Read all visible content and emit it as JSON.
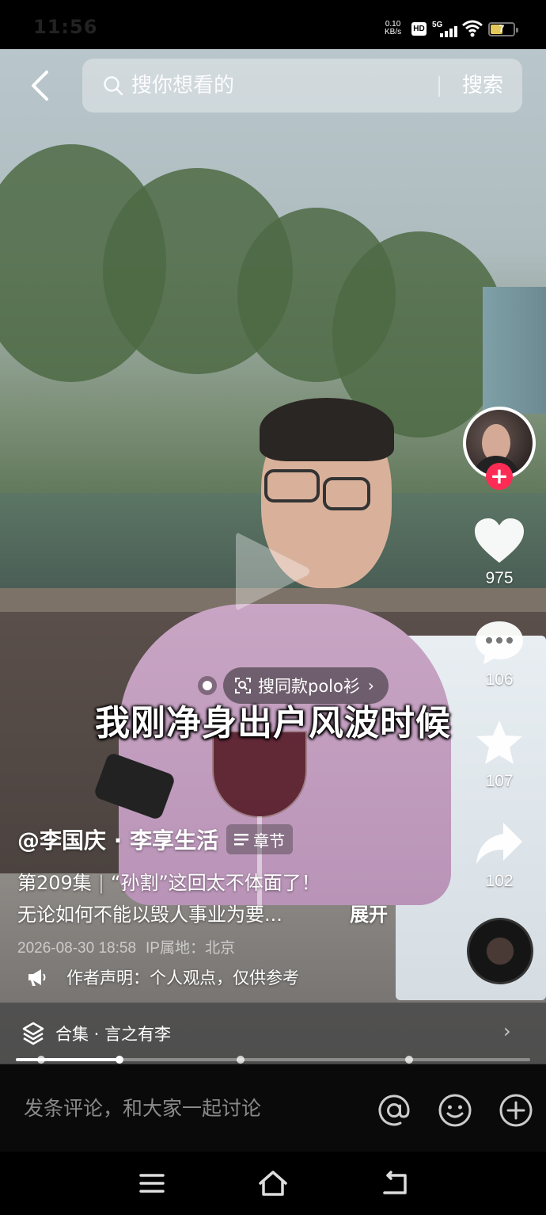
{
  "status_bar": {
    "time": "11:56",
    "net_speed_value": "0.10",
    "net_speed_unit": "KB/s",
    "hd_label": "HD",
    "network_label": "5G",
    "battery_level": "7"
  },
  "search": {
    "placeholder": "搜你想看的",
    "button_label": "搜索"
  },
  "product_tag": {
    "label": "搜同款polo衫",
    "chevron": "›"
  },
  "subtitle": "我刚净身出户风波时候",
  "actions": {
    "likes": "975",
    "comments": "106",
    "favorites": "107",
    "shares": "102"
  },
  "caption": {
    "author": "@李国庆 · 李享生活",
    "chapter_label": "章节",
    "episode": "第209集",
    "episode_sep": "|",
    "line1_text": "“孙割”这回太不体面了！",
    "line2_text": "无论如何不能以毁人事业为要...",
    "expand_label": "展开",
    "date": "2026-08-30 18:58",
    "ip_location": "IP属地：北京",
    "disclaimer": "作者声明：个人观点，仅供参考"
  },
  "collection": {
    "label": "合集 · 言之有李",
    "progress": 0.2
  },
  "comment_bar": {
    "placeholder": "发条评论，和大家一起讨论"
  },
  "icons": {
    "back": "chevron-left-icon",
    "search": "search-icon",
    "like": "heart-icon",
    "comment": "speech-bubble-icon",
    "favorite": "star-icon",
    "share": "share-arrow-icon",
    "mention": "at-icon",
    "emoji": "smiley-icon",
    "add": "plus-circle-icon"
  },
  "colors": {
    "follow_accent": "#fe2c55",
    "battery_fill": "#e4c95a",
    "comment_bar_bg": "#0a0a0a"
  }
}
